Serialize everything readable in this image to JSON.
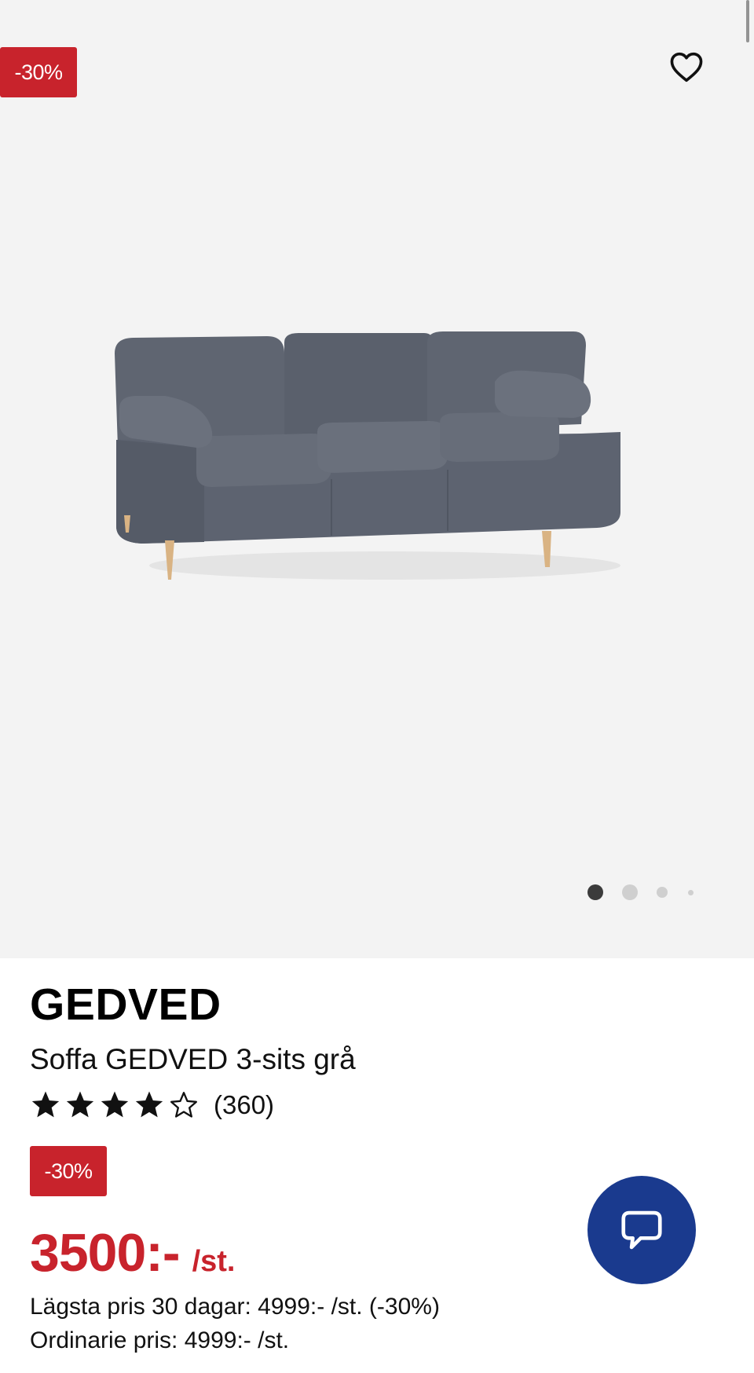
{
  "gallery": {
    "discount_badge": "-30%",
    "image_alt": "Soffa GEDVED 3-sits grå",
    "dots_count": 4,
    "active_dot": 1
  },
  "product": {
    "brand": "GEDVED",
    "name": "Soffa GEDVED 3-sits grå",
    "rating": 4,
    "rating_max": 5,
    "review_count": "(360)",
    "discount_badge": "-30%",
    "price": "3500:-",
    "unit": "/st.",
    "lowest_price": "Lägsta pris 30 dagar: 4999:- /st. (-30%)",
    "regular_price": "Ordinarie pris: 4999:- /st."
  },
  "colors": {
    "accent_red": "#c8232c",
    "chat_blue": "#1a3a8e",
    "gallery_bg": "#f3f3f3"
  },
  "icons": {
    "favorite": "heart-outline-icon",
    "chat": "speech-bubble-icon",
    "star_full": "star-filled-icon",
    "star_empty": "star-outline-icon"
  }
}
